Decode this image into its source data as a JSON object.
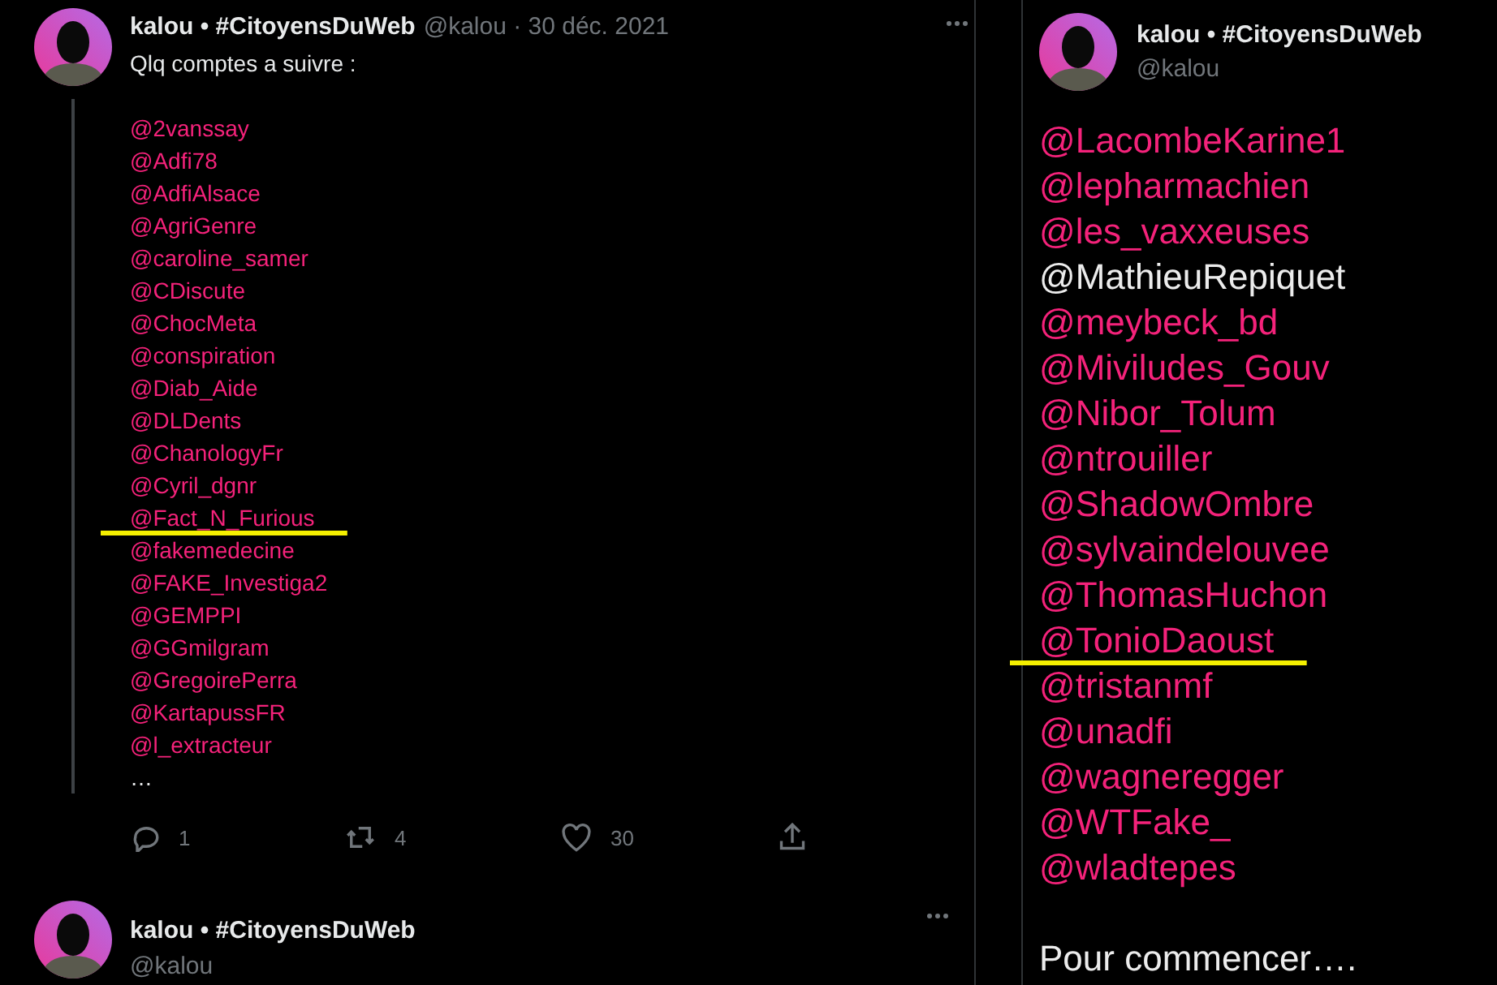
{
  "left_thread": {
    "tweet": {
      "author": "kalou • #CitoyensDuWeb",
      "meta": "@kalou · 30 déc. 2021",
      "text": "Qlq comptes a suivre :",
      "mentions": [
        {
          "text": "@2vanssay",
          "highlighted": false
        },
        {
          "text": "@Adfi78",
          "highlighted": false
        },
        {
          "text": "@AdfiAlsace",
          "highlighted": false
        },
        {
          "text": "@AgriGenre",
          "highlighted": false
        },
        {
          "text": "@caroline_samer",
          "highlighted": false
        },
        {
          "text": "@CDiscute",
          "highlighted": false
        },
        {
          "text": "@ChocMeta",
          "highlighted": false
        },
        {
          "text": "@conspiration",
          "highlighted": false
        },
        {
          "text": "@Diab_Aide",
          "highlighted": false
        },
        {
          "text": "@DLDents",
          "highlighted": false
        },
        {
          "text": "@ChanologyFr",
          "highlighted": false
        },
        {
          "text": "@Cyril_dgnr",
          "highlighted": false
        },
        {
          "text": "@Fact_N_Furious",
          "highlighted": true
        },
        {
          "text": "@fakemedecine",
          "highlighted": false
        },
        {
          "text": "@FAKE_Investiga2",
          "highlighted": false
        },
        {
          "text": "@GEMPPI",
          "highlighted": false
        },
        {
          "text": "@GGmilgram",
          "highlighted": false
        },
        {
          "text": "@GregoirePerra",
          "highlighted": false
        },
        {
          "text": "@KartapussFR",
          "highlighted": false
        },
        {
          "text": "@l_extracteur",
          "highlighted": false
        }
      ],
      "more": "…",
      "actions": [
        {
          "kind": "reply",
          "count": "1"
        },
        {
          "kind": "retweet",
          "count": "4"
        },
        {
          "kind": "like",
          "count": "30"
        },
        {
          "kind": "share"
        }
      ]
    },
    "reply_tweet": {
      "author": "kalou • #CitoyensDuWeb",
      "handle": "@kalou"
    }
  },
  "right_tweet": {
    "author": "kalou • #CitoyensDuWeb",
    "handle": "@kalou",
    "lines": [
      {
        "text": "@LacombeKarine1",
        "link": true,
        "highlighted": false
      },
      {
        "text": "@lepharmachien",
        "link": true,
        "highlighted": false
      },
      {
        "text": "@les_vaxxeuses",
        "link": true,
        "highlighted": false
      },
      {
        "text": "@MathieuRepiquet",
        "link": false,
        "highlighted": false
      },
      {
        "text": "@meybeck_bd",
        "link": true,
        "highlighted": false
      },
      {
        "text": "@Miviludes_Gouv",
        "link": true,
        "highlighted": false
      },
      {
        "text": "@Nibor_Tolum",
        "link": true,
        "highlighted": false
      },
      {
        "text": "@ntrouiller",
        "link": true,
        "highlighted": false
      },
      {
        "text": "@ShadowOmbre",
        "link": true,
        "highlighted": false
      },
      {
        "text": "@sylvaindelouvee",
        "link": true,
        "highlighted": false
      },
      {
        "text": "@ThomasHuchon",
        "link": true,
        "highlighted": false
      },
      {
        "text": "@TonioDaoust",
        "link": true,
        "highlighted": true
      },
      {
        "text": "@tristanmf",
        "link": true,
        "highlighted": false
      },
      {
        "text": "@unadfi",
        "link": true,
        "highlighted": false
      },
      {
        "text": "@wagneregger",
        "link": true,
        "highlighted": false
      },
      {
        "text": "@WTFake_",
        "link": true,
        "highlighted": false
      },
      {
        "text": "@wladtepes",
        "link": true,
        "highlighted": false
      }
    ],
    "footer": "Pour commencer…."
  }
}
